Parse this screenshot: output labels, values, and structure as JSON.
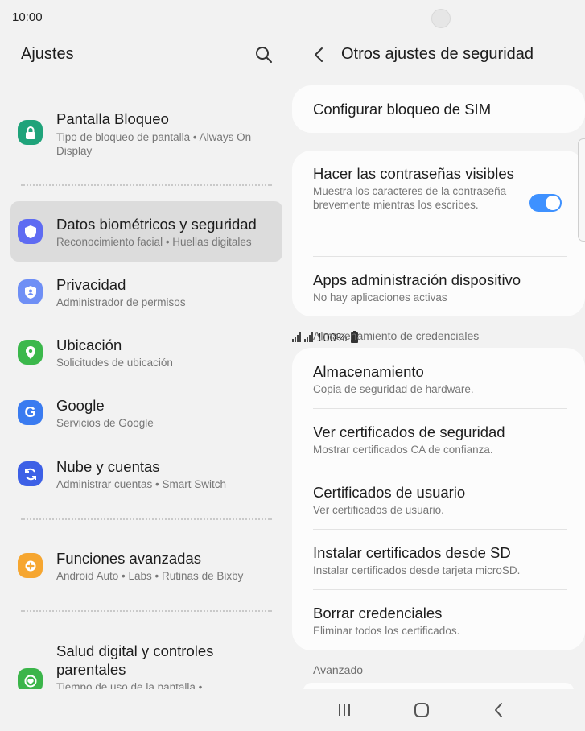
{
  "status_bar": {
    "time": "10:00",
    "battery": "100%"
  },
  "left_pane": {
    "title": "Ajustes",
    "items": [
      {
        "title": "Pantalla Bloqueo",
        "subtitle": "Tipo de bloqueo de pantalla  •  Always On Display",
        "icon": "lock-icon",
        "color": "#1fa37a"
      },
      {
        "title": "Datos biométricos y seguridad",
        "subtitle": "Reconocimiento facial  •  Huellas digitales",
        "icon": "shield-icon",
        "color": "#5e6bf2",
        "selected": true
      },
      {
        "title": "Privacidad",
        "subtitle": "Administrador de permisos",
        "icon": "privacy-icon",
        "color": "#6f8ff5"
      },
      {
        "title": "Ubicación",
        "subtitle": "Solicitudes de ubicación",
        "icon": "location-icon",
        "color": "#3bb84b"
      },
      {
        "title": "Google",
        "subtitle": "Servicios de Google",
        "icon": "google-icon",
        "color": "#3a7bf0"
      },
      {
        "title": "Nube y cuentas",
        "subtitle": "Administrar cuentas  •  Smart Switch",
        "icon": "sync-icon",
        "color": "#3d60e6"
      },
      {
        "title": "Funciones avanzadas",
        "subtitle": "Android Auto  •  Labs  •  Rutinas de Bixby",
        "icon": "gear-plus-icon",
        "color": "#f6a630"
      },
      {
        "title": "Salud digital y controles parentales",
        "subtitle": "Tiempo de uso de la pantalla  •",
        "icon": "wellbeing-icon",
        "color": "#3bb54a"
      }
    ]
  },
  "right_pane": {
    "title": "Otros ajustes de seguridad",
    "sim_lock": "Configurar bloqueo de SIM",
    "passwords_visible": {
      "title": "Hacer las contraseñas visibles",
      "subtitle": "Muestra los caracteres de la contraseña brevemente mientras los escribes.",
      "enabled": true
    },
    "device_admin": {
      "title": "Apps administración dispositivo",
      "subtitle": "No hay aplicaciones activas"
    },
    "credential_storage_label": "Almacenamiento de credenciales",
    "credential_rows": [
      {
        "title": "Almacenamiento",
        "subtitle": "Copia de seguridad de hardware."
      },
      {
        "title": "Ver certificados de seguridad",
        "subtitle": "Mostrar certificados CA de confianza."
      },
      {
        "title": "Certificados de usuario",
        "subtitle": "Ver certificados de usuario."
      },
      {
        "title": "Instalar certificados desde SD",
        "subtitle": "Instalar certificados desde tarjeta microSD."
      },
      {
        "title": "Borrar credenciales",
        "subtitle": "Eliminar todos los certificados."
      }
    ],
    "advanced_label": "Avanzado"
  },
  "colors": {
    "accent": "#3e91ff",
    "selected_bg": "#dcdcdc",
    "background": "#f2f2f2",
    "card": "#fcfcfc"
  }
}
